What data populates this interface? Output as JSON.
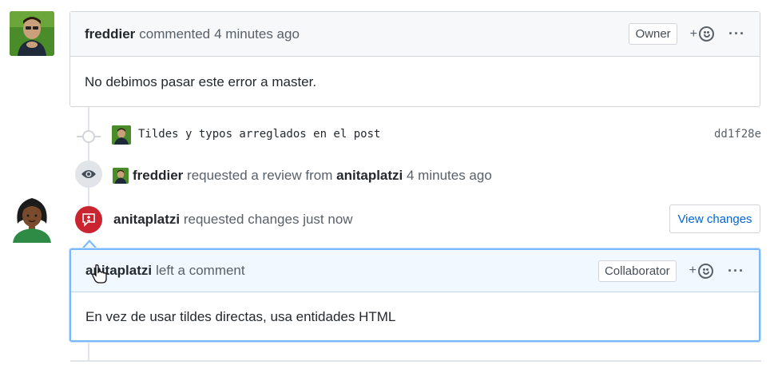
{
  "comment1": {
    "author": "freddier",
    "action": "commented",
    "time": "4 minutes ago",
    "role": "Owner",
    "body": "No debimos pasar este error a master."
  },
  "commit": {
    "message": "Tildes y typos arreglados en el post",
    "sha": "dd1f28e"
  },
  "review_request": {
    "actor": "freddier",
    "text": "requested a review from",
    "reviewer": "anitaplatzi",
    "time": "4 minutes ago"
  },
  "changes": {
    "actor": "anitaplatzi",
    "text": "requested changes just now",
    "button_label": "View changes"
  },
  "comment2": {
    "author": "anitaplatzi",
    "action": "left a comment",
    "role": "Collaborator",
    "body": "En vez de usar tildes directas, usa entidades HTML"
  },
  "reaction": {
    "plus": "+"
  },
  "menu": {
    "dots": "···"
  },
  "colors": {
    "link": "#0366d6",
    "changes_badge": "#cb2431",
    "active_border": "#79b8ff",
    "header_bg": "#f6f8fa"
  }
}
